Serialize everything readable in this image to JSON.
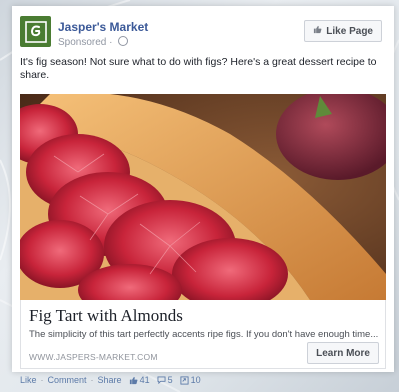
{
  "post": {
    "page_name": "Jasper's Market",
    "sponsored": "Sponsored",
    "like_page": "Like Page",
    "text": "It's fig season! Not sure what to do with figs? Here's a great dessert recipe to share."
  },
  "link": {
    "title": "Fig Tart with Almonds",
    "description": "The simplicity of this tart perfectly accents ripe figs. If you don't have enough time...",
    "domain": "WWW.JASPERS-MARKET.COM",
    "cta": "Learn More"
  },
  "actions": {
    "like": "Like",
    "comment": "Comment",
    "share": "Share",
    "like_count": "41",
    "comment_count": "5",
    "share_count": "10"
  },
  "icons": {
    "logo": "jaspers-market-logo",
    "thumb": "thumbs-up-icon",
    "globe": "globe-icon",
    "comment": "comment-bubble-icon",
    "share": "share-icon"
  },
  "colors": {
    "brand_blue": "#3b5998",
    "logo_green": "#4a7c32"
  }
}
